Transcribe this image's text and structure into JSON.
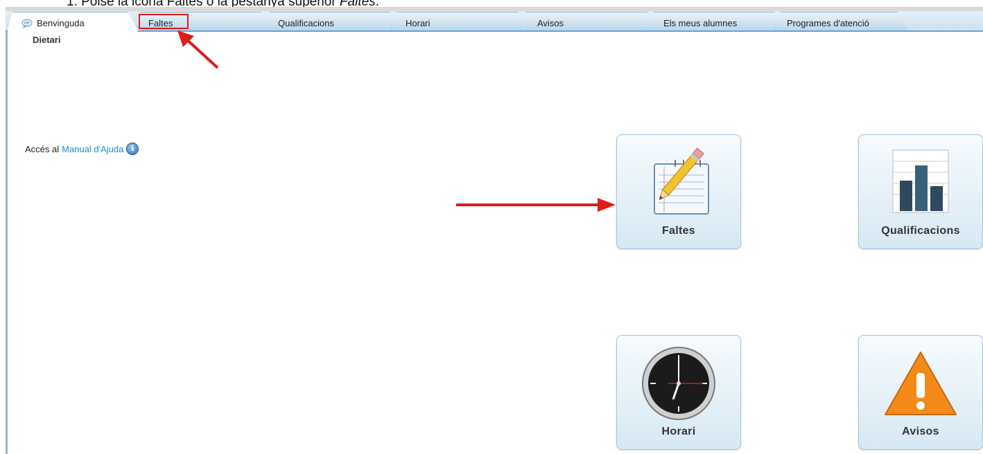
{
  "instruction": {
    "prefix": "1.  Polse la icona Faltes o la pestanya superior ",
    "emph": "Faltes",
    "suffix": "."
  },
  "tabs": [
    {
      "label": "Benvinguda",
      "icon": "speech-bubble-icon",
      "active": true
    },
    {
      "label": "Faltes",
      "active": false,
      "highlighted": true
    },
    {
      "label": "Qualificacions",
      "active": false
    },
    {
      "label": "Horari",
      "active": false
    },
    {
      "label": "Avisos",
      "active": false
    },
    {
      "label": "Els meus alumnes",
      "active": false
    },
    {
      "label": "Programes d'atenció",
      "active": false
    }
  ],
  "sublink": "Dietari",
  "help": {
    "prefix": "Accés al",
    "link": "Manual d'Ajuda",
    "icon": "info-icon",
    "icon_glyph": "i"
  },
  "tiles": [
    {
      "label": "Faltes",
      "icon": "notepad-pencil-icon"
    },
    {
      "label": "Qualificacions",
      "icon": "bar-chart-icon"
    },
    {
      "label": "Horari",
      "icon": "clock-icon"
    },
    {
      "label": "Avisos",
      "icon": "warning-triangle-icon"
    }
  ],
  "annotation_color": "#e01b1b",
  "accent_color": "#1a8fd6"
}
